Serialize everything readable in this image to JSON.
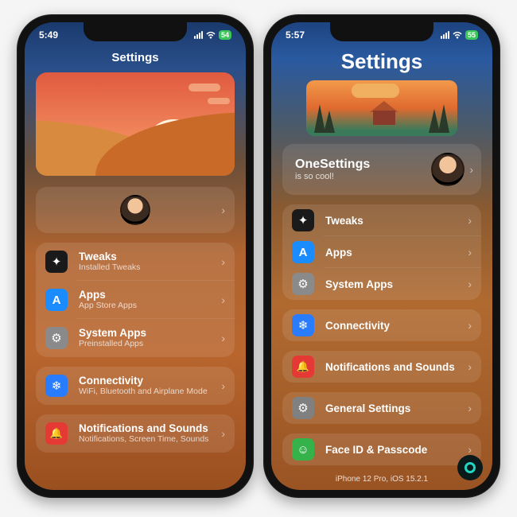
{
  "left": {
    "status": {
      "time": "5:49",
      "battery": "54"
    },
    "title": "Settings",
    "groups": [
      {
        "rows": [
          {
            "icon": "tweaks",
            "title": "Tweaks",
            "sub": "Installed Tweaks"
          },
          {
            "icon": "apps",
            "title": "Apps",
            "sub": "App Store Apps"
          },
          {
            "icon": "sys",
            "title": "System Apps",
            "sub": "Preinstalled Apps"
          }
        ]
      },
      {
        "rows": [
          {
            "icon": "conn",
            "title": "Connectivity",
            "sub": "WiFi, Bluetooth and Airplane Mode"
          }
        ]
      },
      {
        "rows": [
          {
            "icon": "notif",
            "title": "Notifications and Sounds",
            "sub": "Notifications, Screen Time, Sounds"
          }
        ]
      }
    ]
  },
  "right": {
    "status": {
      "time": "5:57",
      "battery": "55"
    },
    "title": "Settings",
    "profile": {
      "title": "OneSettings",
      "sub": "is so cool!"
    },
    "groups": [
      {
        "rows": [
          {
            "icon": "tweaks",
            "title": "Tweaks"
          },
          {
            "icon": "apps",
            "title": "Apps"
          },
          {
            "icon": "sys",
            "title": "System Apps"
          }
        ]
      },
      {
        "rows": [
          {
            "icon": "conn",
            "title": "Connectivity"
          }
        ]
      },
      {
        "rows": [
          {
            "icon": "notif",
            "title": "Notifications and Sounds"
          }
        ]
      },
      {
        "rows": [
          {
            "icon": "gen",
            "title": "General Settings"
          }
        ]
      },
      {
        "rows": [
          {
            "icon": "face",
            "title": "Face ID & Passcode"
          }
        ]
      }
    ],
    "footer": "iPhone 12 Pro, iOS 15.2.1"
  },
  "icons": {
    "tweaks": "✦",
    "apps": "A",
    "sys": "⚙",
    "conn": "❄",
    "notif": "🔔",
    "gen": "⚙",
    "face": "☺"
  }
}
